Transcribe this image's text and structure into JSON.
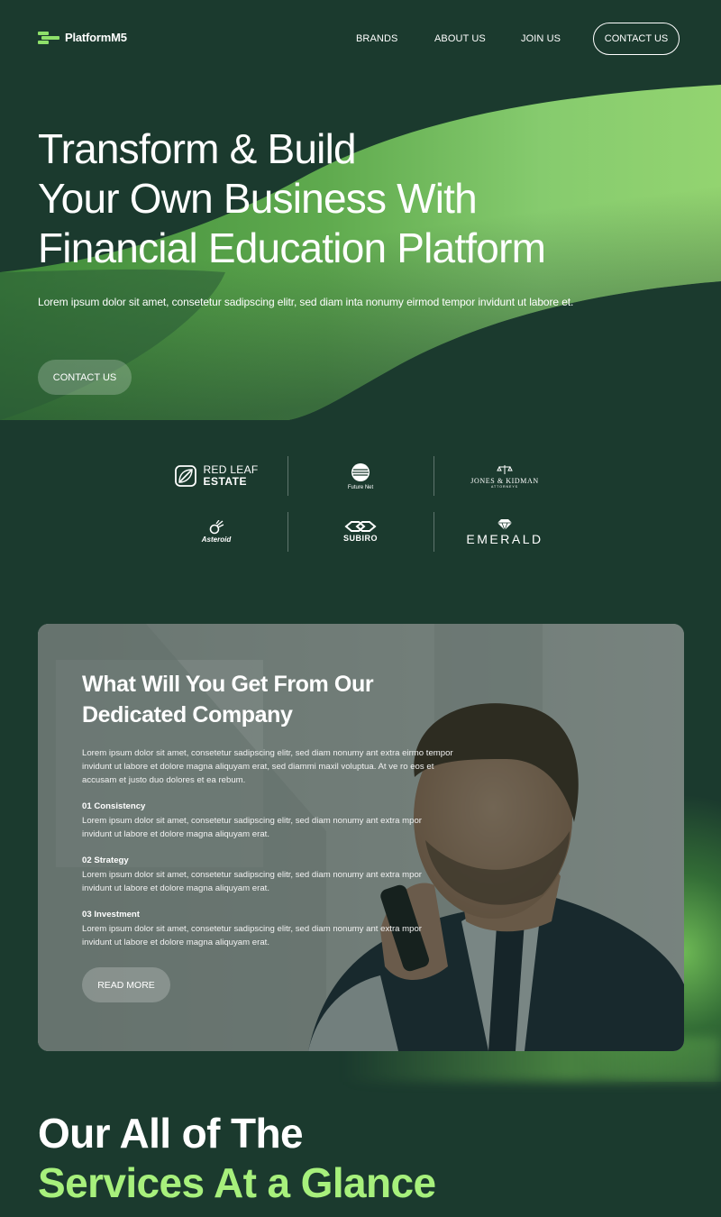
{
  "header": {
    "logo_text": "PlatformM5",
    "nav": [
      {
        "label": "BRANDS"
      },
      {
        "label": "ABOUT US"
      },
      {
        "label": "JOIN US"
      }
    ],
    "contact_label": "CONTACT US"
  },
  "hero": {
    "title_lines": [
      "Transform & Build",
      "Your Own Business With",
      "Financial Education Platform"
    ],
    "subtitle": "Lorem ipsum dolor sit amet, consetetur sadipscing elitr, sed diam inta nonumy eirmod tempor invidunt ut labore et.",
    "cta_label": "CONTACT US"
  },
  "brands": {
    "red_leaf_line1": "RED LEAF",
    "red_leaf_line2": "ESTATE",
    "future_net": "Future Net",
    "jones_kidman": "JONES & KIDMAN",
    "jones_kidman_sub": "ATTORNEYS",
    "asteroid": "Asteroid",
    "subiro": "SUBIRO",
    "emerald": "EMERALD"
  },
  "feature": {
    "title_line1": "What Will You Get From Our",
    "title_line2": "Dedicated Company",
    "intro": "Lorem ipsum dolor sit amet, consetetur sadipscing elitr, sed diam nonumy ant extra eirmo tempor invidunt ut labore et dolore magna aliquyam erat, sed diammi maxil voluptua. At ve ro eos et accusam et justo duo dolores et ea rebum.",
    "items": [
      {
        "title": "01  Consistency",
        "text": "Lorem ipsum dolor sit amet, consetetur sadipscing elitr, sed diam nonumy ant extra mpor invidunt ut labore et dolore magna aliquyam erat."
      },
      {
        "title": "02 Strategy",
        "text": "Lorem ipsum dolor sit amet, consetetur sadipscing elitr, sed diam nonumy ant extra mpor invidunt ut labore et dolore magna aliquyam erat."
      },
      {
        "title": "03 Investment",
        "text": "Lorem ipsum dolor sit amet, consetetur sadipscing elitr, sed diam nonumy ant extra mpor invidunt ut labore et dolore magna aliquyam erat."
      }
    ],
    "read_more_label": "READ MORE"
  },
  "services": {
    "line1": "Our All of The",
    "line2": "Services At a Glance"
  },
  "colors": {
    "background": "#1b3a2e",
    "accent_green": "#8ee06a",
    "heading_green": "#a7f07c"
  }
}
